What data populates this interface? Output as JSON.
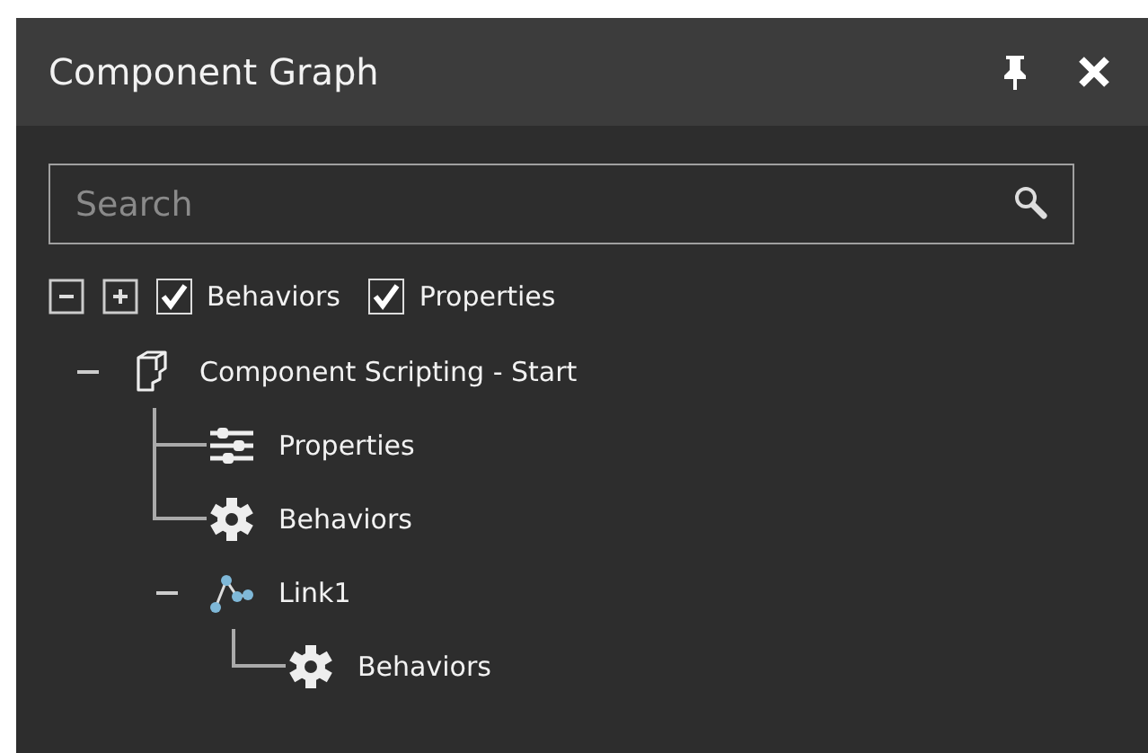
{
  "window": {
    "title": "Component Graph"
  },
  "search": {
    "placeholder": "Search"
  },
  "filters": [
    {
      "label": "Behaviors",
      "checked": true
    },
    {
      "label": "Properties",
      "checked": true
    }
  ],
  "tree": [
    {
      "kind": "component",
      "label": "Component Scripting - Start",
      "expanded": true,
      "children": [
        {
          "kind": "properties",
          "label": "Properties"
        },
        {
          "kind": "behaviors",
          "label": "Behaviors"
        },
        {
          "kind": "link",
          "label": "Link1",
          "expanded": true,
          "children": [
            {
              "kind": "behaviors",
              "label": "Behaviors"
            }
          ]
        }
      ]
    }
  ]
}
